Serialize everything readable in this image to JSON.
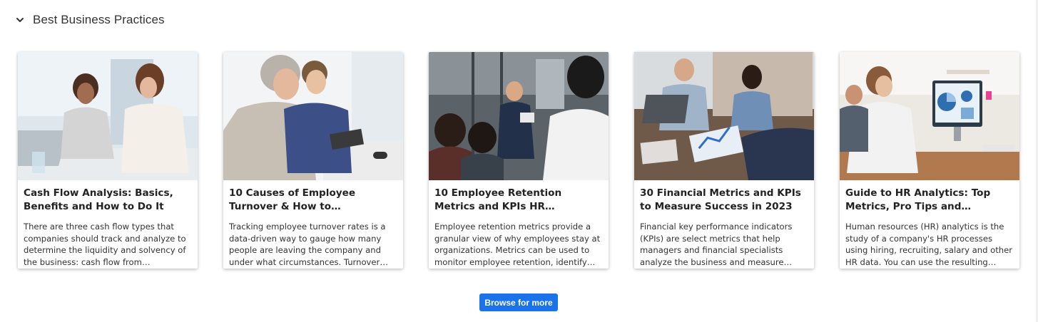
{
  "section": {
    "title": "Best Business Practices",
    "toggle_icon": "chevron-down-icon"
  },
  "cards": [
    {
      "title": "Cash Flow Analysis: Basics, Benefits and How to Do It",
      "description": "There are three cash flow types that companies should track and analyze to determine the liquidity and solvency of the business: cash flow from operating…",
      "image": "photo of two women reviewing documents at a laptop"
    },
    {
      "title": "10 Causes of Employee Turnover & How to Prevent/Reduce Them",
      "description": "Tracking employee turnover rates is a data-driven way to gauge how many people are leaving the company and under what circumstances. Turnover refers to total…",
      "image": "photo of two men looking at a laptop"
    },
    {
      "title": "10 Employee Retention Metrics and KPIs HR Departments…",
      "description": "Employee retention metrics provide a granular view of why employees stay at organizations. Metrics can be used to monitor employee retention, identify at-…",
      "image": "photo of a team meeting in an office"
    },
    {
      "title": "30 Financial Metrics and KPIs to Measure Success in 2023",
      "description": "Financial key performance indicators (KPIs) are select metrics that help managers and financial specialists analyze the business and measure progress toward strategic…",
      "image": "photo of people around a table with tablet charts"
    },
    {
      "title": "Guide to HR Analytics: Top Metrics, Pro Tips and Templates",
      "description": "Human resources (HR) analytics is the study of a company's HR processes using hiring, recruiting, salary and other HR data. You can use the resulting insights to…",
      "image": "photo of a woman at a monitor showing pie charts"
    }
  ],
  "browse_button": {
    "label": "Browse for more"
  },
  "colors": {
    "accent": "#1a73e8",
    "text": "#222222"
  }
}
